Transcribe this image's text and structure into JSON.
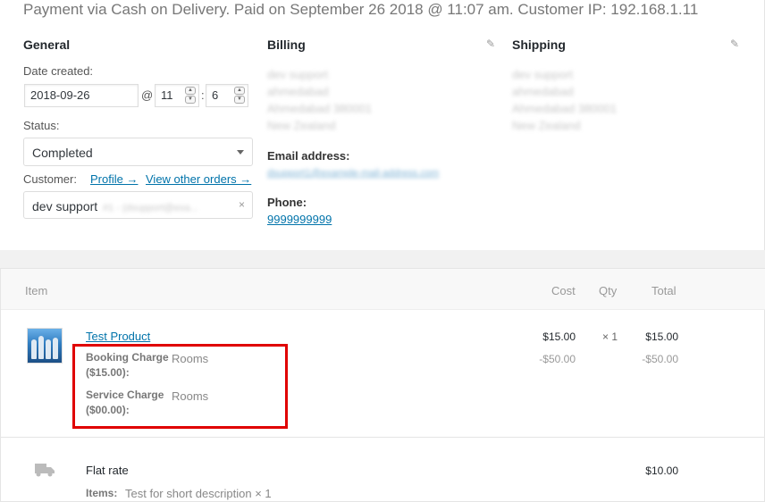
{
  "order": {
    "payment_line": "Payment via Cash on Delivery. Paid on September 26 2018 @ 11:07 am. Customer IP: 192.168.1.11"
  },
  "general": {
    "title": "General",
    "date_label": "Date created:",
    "date_value": "2018-09-26",
    "at_sign": "@",
    "hour": "11",
    "minute": "6",
    "colon": ":",
    "status_label": "Status:",
    "status_value": "Completed",
    "customer_label": "Customer:",
    "profile_link": "Profile →",
    "other_orders_link": "View other orders →",
    "customer_value": "dev support",
    "customer_hidden": "#1 - (dsupport@exa...",
    "customer_clear": "×"
  },
  "billing": {
    "title": "Billing",
    "address_lines": [
      "dev support",
      "ahmedabad",
      "Ahmedabad 380001",
      "New Zealand"
    ],
    "email_label": "Email address:",
    "email_value": "dsupport1@example-mail-address.com",
    "phone_label": "Phone:",
    "phone_value": "9999999999"
  },
  "shipping": {
    "title": "Shipping",
    "address_lines": [
      "dev support",
      "ahmedabad",
      "Ahmedabad 380001",
      "New Zealand"
    ]
  },
  "items": {
    "headers": {
      "item": "Item",
      "cost": "Cost",
      "qty": "Qty",
      "total": "Total"
    },
    "product": {
      "name": "Test Product",
      "cost": "$15.00",
      "qty": "× 1",
      "total": "$15.00",
      "cost_adj": "-$50.00",
      "total_adj": "-$50.00",
      "meta": [
        {
          "key_line1": "Booking Charge",
          "key_line2": "($15.00):",
          "value": "Rooms"
        },
        {
          "key_line1": "Service Charge",
          "key_line2": "($00.00):",
          "value": "Rooms"
        }
      ]
    },
    "shipping_line": {
      "name": "Flat rate",
      "total": "$10.00",
      "items_label": "Items:",
      "items_value": "Test for short description × 1"
    }
  },
  "colors": {
    "link": "#0073aa",
    "highlight_box": "#e00000"
  }
}
